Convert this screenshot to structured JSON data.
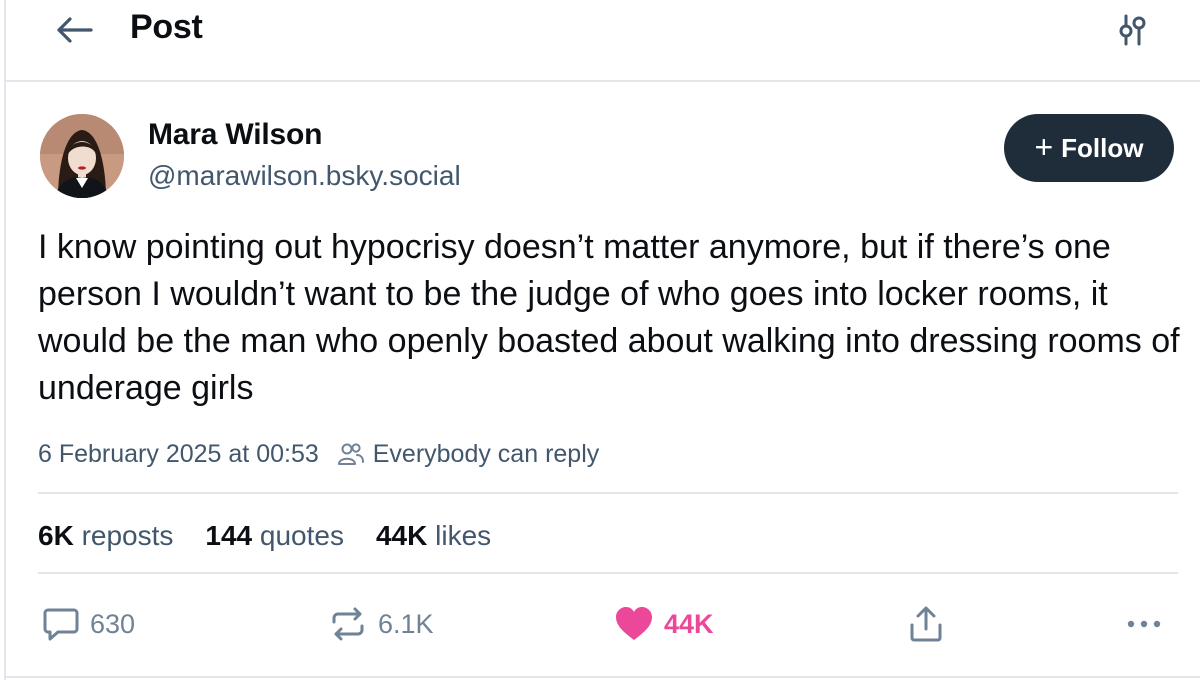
{
  "header": {
    "title": "Post",
    "back_icon": "arrow-left-icon",
    "options_icon": "sliders-icon"
  },
  "author": {
    "name": "Mara Wilson",
    "handle": "@marawilson.bsky.social",
    "follow_label": "Follow"
  },
  "post": {
    "text": "I know pointing out hypocrisy doesn’t matter anymore, but if there’s one person I wouldn’t want to be the judge of who goes into locker rooms, it would be the man who openly boasted about walking into dressing rooms of underage girls",
    "timestamp": "6 February 2025 at 00:53",
    "reply_setting": "Everybody can reply"
  },
  "stats": {
    "reposts_count": "6K",
    "reposts_label": "reposts",
    "quotes_count": "144",
    "quotes_label": "quotes",
    "likes_count": "44K",
    "likes_label": "likes"
  },
  "actions": {
    "reply_count": "630",
    "repost_count": "6.1K",
    "like_count": "44K"
  },
  "colors": {
    "follow_bg": "#1f2d3b",
    "like_accent": "#ec4899",
    "muted_text": "#42576c",
    "divider": "#e3e7ec"
  }
}
